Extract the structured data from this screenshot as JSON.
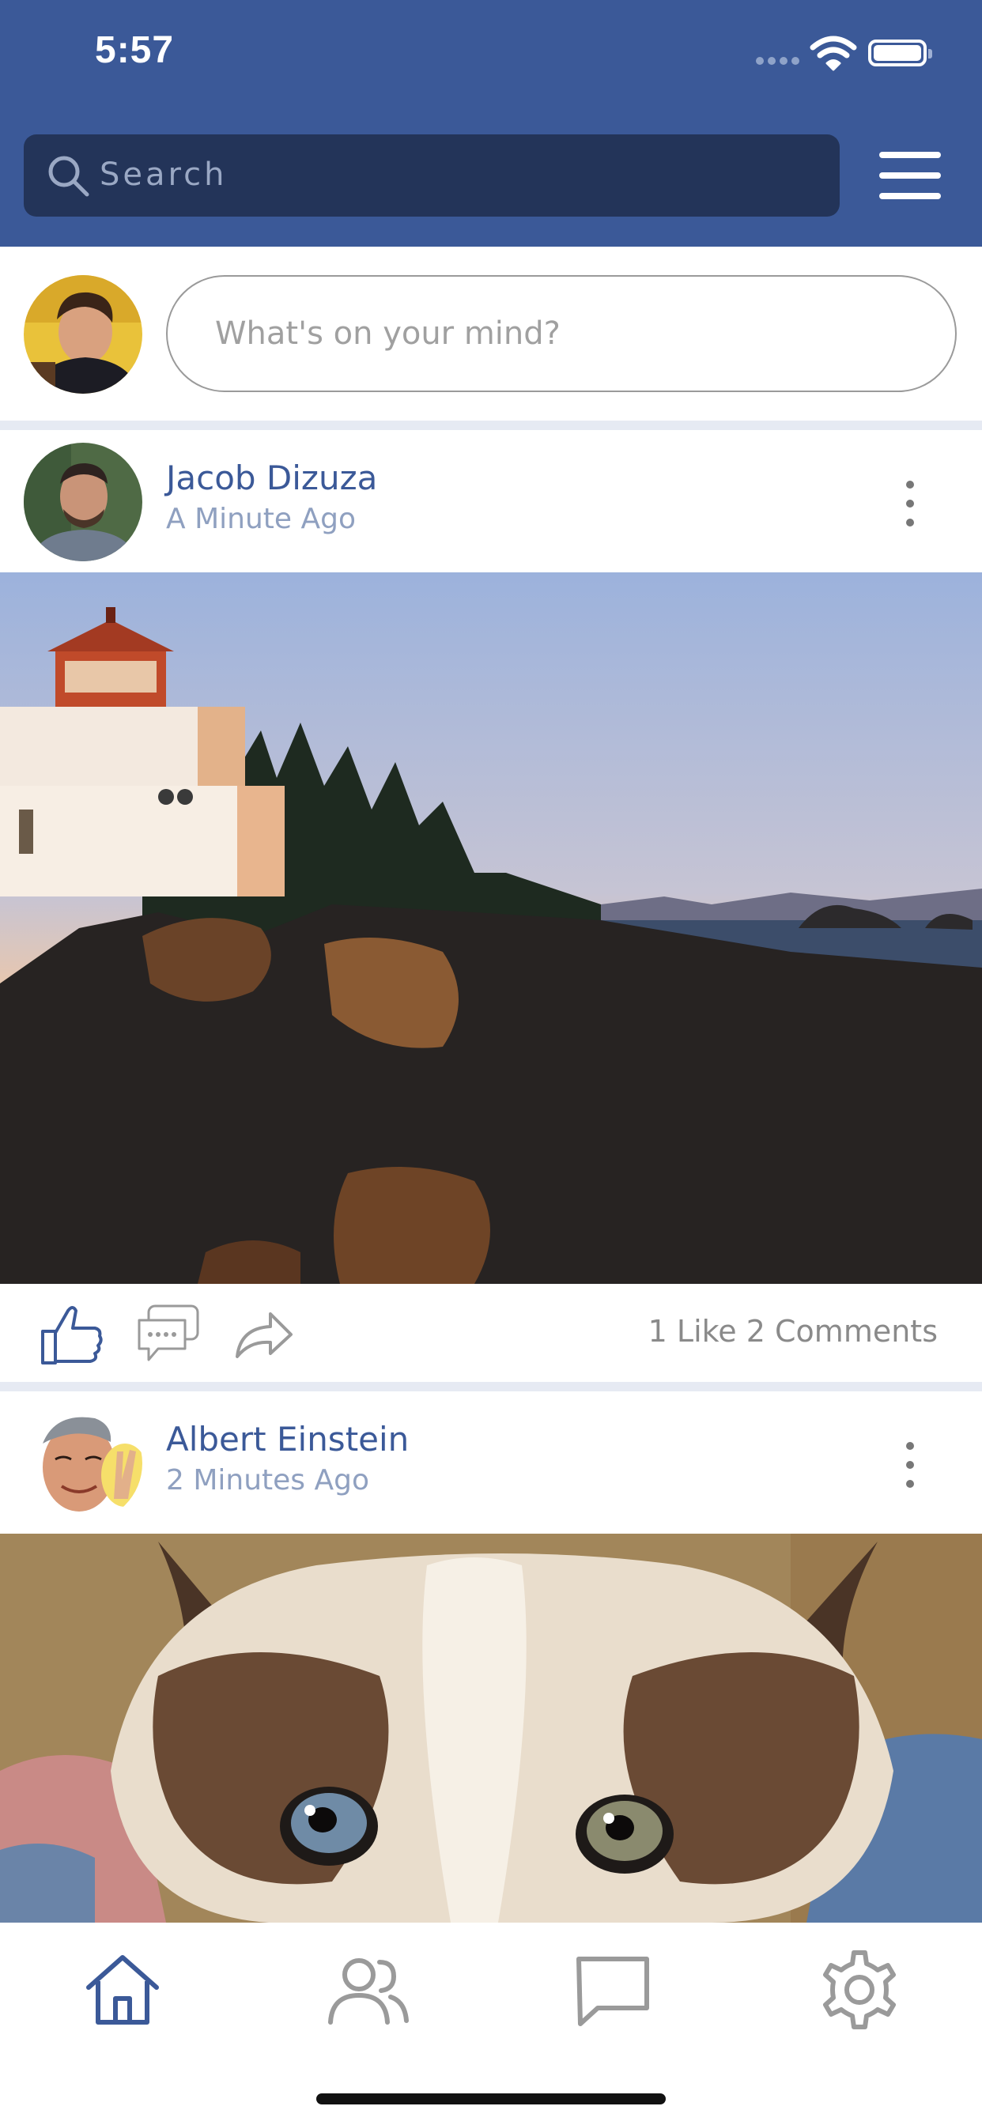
{
  "status_bar": {
    "time": "5:57"
  },
  "search": {
    "placeholder": "Search"
  },
  "composer": {
    "placeholder": "What's on your mind?"
  },
  "posts": [
    {
      "author": "Jacob Dizuza",
      "time": "A Minute Ago",
      "stats": "1 Like 2 Comments",
      "image": "lighthouse-photo"
    },
    {
      "author": "Albert Einstein",
      "time": "2 Minutes Ago",
      "image": "cat-photo"
    }
  ],
  "tabs": [
    "home",
    "friends",
    "messages",
    "settings"
  ],
  "colors": {
    "brand": "#3b5998",
    "search_bg": "#233459",
    "divider": "#e6eaf3"
  }
}
